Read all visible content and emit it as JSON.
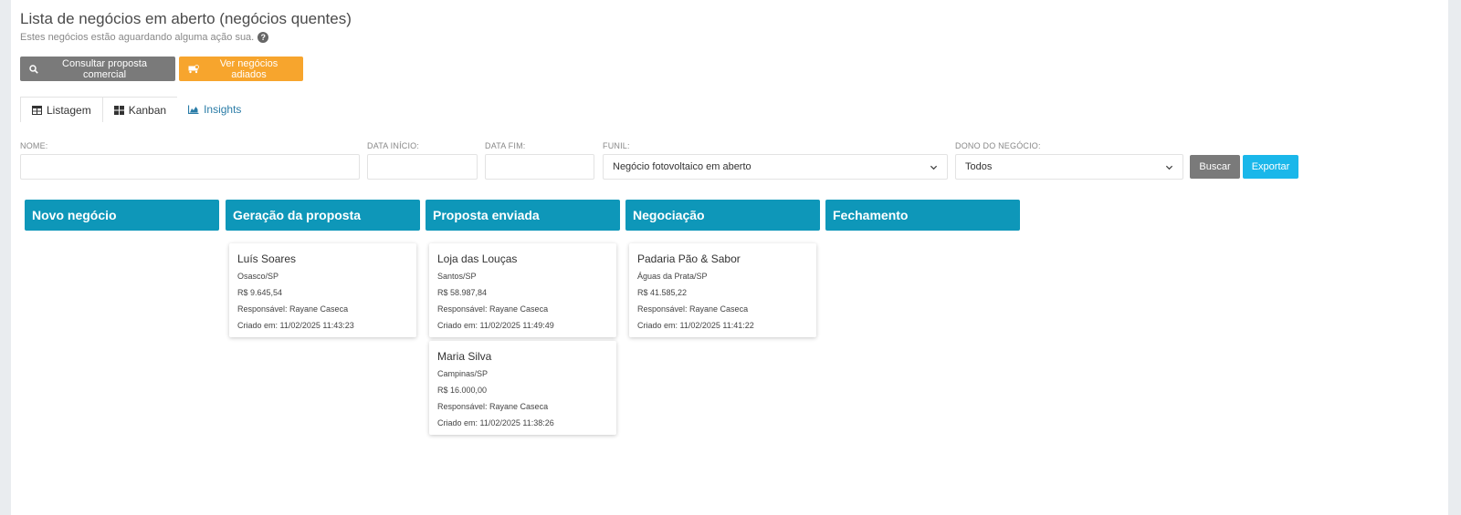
{
  "page": {
    "title": "Lista de negócios em aberto (negócios quentes)",
    "subtitle": "Estes negócios estão aguardando alguma ação sua.",
    "help_glyph": "?"
  },
  "actions": {
    "consult_label": "Consultar proposta comercial",
    "postponed_label": "Ver negócios adiados"
  },
  "tabs": [
    {
      "label": "Listagem",
      "icon": "table-icon"
    },
    {
      "label": "Kanban",
      "icon": "kanban-icon"
    },
    {
      "label": "Insights",
      "icon": "chart-icon"
    }
  ],
  "filters": {
    "name_label": "NOME:",
    "name_value": "",
    "start_label": "DATA INÍCIO:",
    "start_value": "",
    "end_label": "DATA FIM:",
    "end_value": "",
    "funnel_label": "FUNIL:",
    "funnel_value": "Negócio fotovoltaico em aberto",
    "owner_label": "DONO DO NEGÓCIO:",
    "owner_value": "Todos",
    "search_label": "Buscar",
    "export_label": "Exportar"
  },
  "columns": [
    {
      "title": "Novo negócio",
      "cards": []
    },
    {
      "title": "Geração da proposta",
      "cards": [
        {
          "name": "Luís Soares",
          "location": "Osasco/SP",
          "value": "R$ 9.645,54",
          "owner": "Responsável: Rayane Caseca",
          "created": "Criado em: 11/02/2025 11:43:23"
        }
      ]
    },
    {
      "title": "Proposta enviada",
      "cards": [
        {
          "name": "Loja das Louças",
          "location": "Santos/SP",
          "value": "R$ 58.987,84",
          "owner": "Responsável: Rayane Caseca",
          "created": "Criado em: 11/02/2025 11:49:49"
        },
        {
          "name": "Maria Silva",
          "location": "Campinas/SP",
          "value": "R$ 16.000,00",
          "owner": "Responsável: Rayane Caseca",
          "created": "Criado em: 11/02/2025 11:38:26"
        }
      ]
    },
    {
      "title": "Negociação",
      "cards": [
        {
          "name": "Padaria Pão & Sabor",
          "location": "Águas da Prata/SP",
          "value": "R$ 41.585,22",
          "owner": "Responsável: Rayane Caseca",
          "created": "Criado em: 11/02/2025 11:41:22"
        }
      ]
    },
    {
      "title": "Fechamento",
      "cards": []
    }
  ],
  "colors": {
    "column_header": "#0e97b9",
    "primary_gray": "#7a7a7a",
    "warning_orange": "#f7a52d",
    "info_blue": "#1ab7ea",
    "link_blue": "#2a7ca7"
  }
}
